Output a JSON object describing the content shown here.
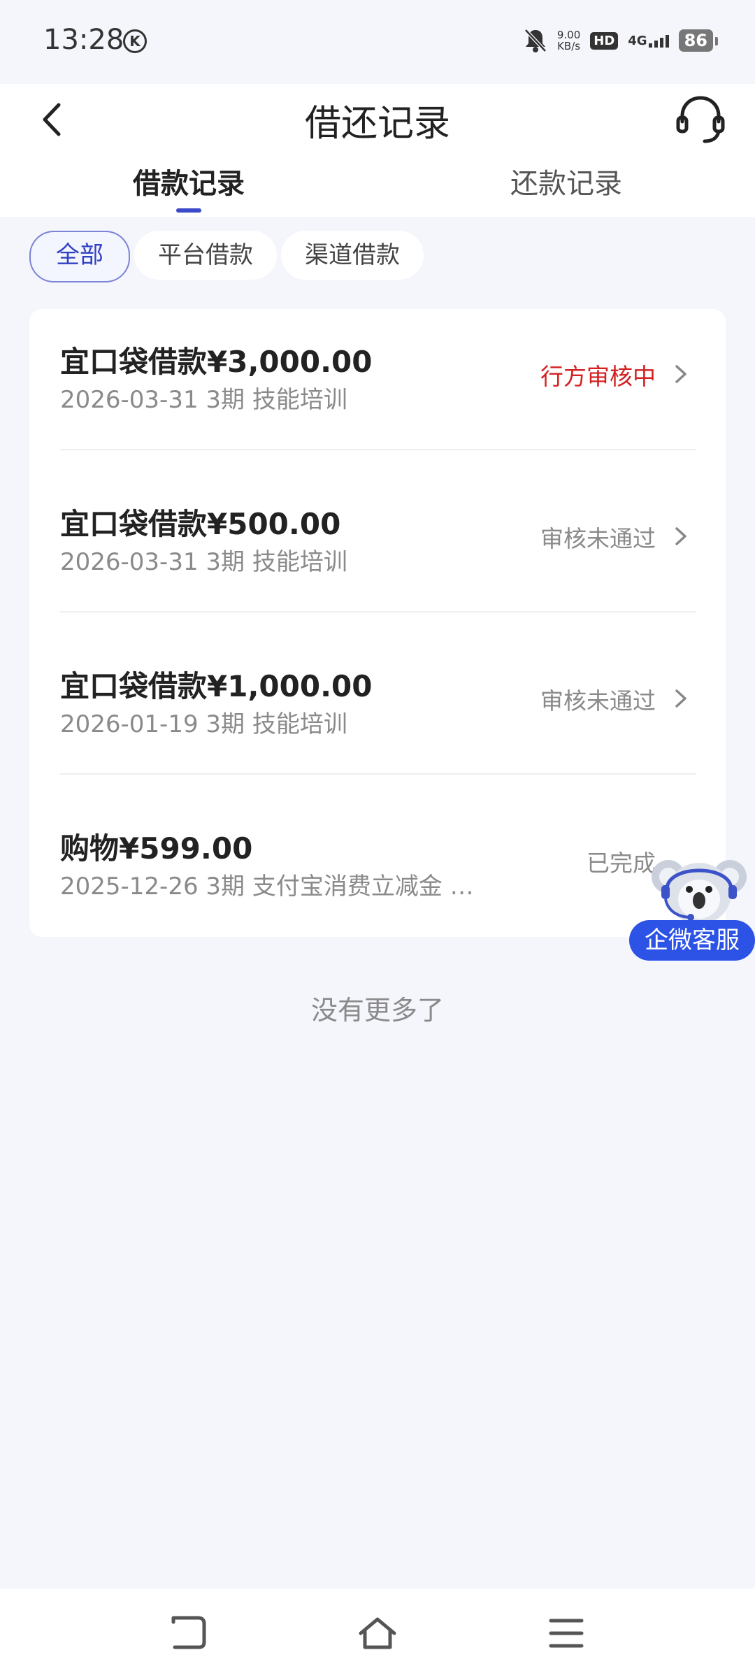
{
  "status_bar": {
    "time": "13:28",
    "k_badge": "K",
    "speed_value": "9.00",
    "speed_unit": "KB/s",
    "hd": "HD",
    "network": "4G",
    "battery": "86"
  },
  "header": {
    "title": "借还记录",
    "back_icon": "chevron-left-icon",
    "service_icon": "headset-icon"
  },
  "tabs": [
    {
      "label": "借款记录",
      "active": true
    },
    {
      "label": "还款记录",
      "active": false
    }
  ],
  "filters": [
    {
      "label": "全部",
      "active": true
    },
    {
      "label": "平台借款",
      "active": false
    },
    {
      "label": "渠道借款",
      "active": false
    }
  ],
  "records": [
    {
      "title": "宜口袋借款¥3,000.00",
      "subtitle": "2026-03-31 3期  技能培训",
      "status": "行方审核中",
      "status_color": "#d42020"
    },
    {
      "title": "宜口袋借款¥500.00",
      "subtitle": "2026-03-31 3期  技能培训",
      "status": "审核未通过",
      "status_color": "#8a8a8a"
    },
    {
      "title": "宜口袋借款¥1,000.00",
      "subtitle": "2026-01-19 3期  技能培训",
      "status": "审核未通过",
      "status_color": "#8a8a8a"
    },
    {
      "title": "购物¥599.00",
      "subtitle": "2025-12-26 3期  支付宝消费立减金 …",
      "status": "已完成",
      "status_color": "#8a8a8a"
    }
  ],
  "no_more_text": "没有更多了",
  "float_service": {
    "label": "企微客服",
    "icon": "koala-mascot-icon",
    "button_color": "#2c53e6"
  },
  "nav_bar": {
    "back_icon": "nav-back-icon",
    "home_icon": "nav-home-icon",
    "menu_icon": "nav-menu-icon"
  },
  "colors": {
    "accent": "#3b4ac9",
    "background": "#f5f6fc",
    "status_red": "#d42020"
  }
}
